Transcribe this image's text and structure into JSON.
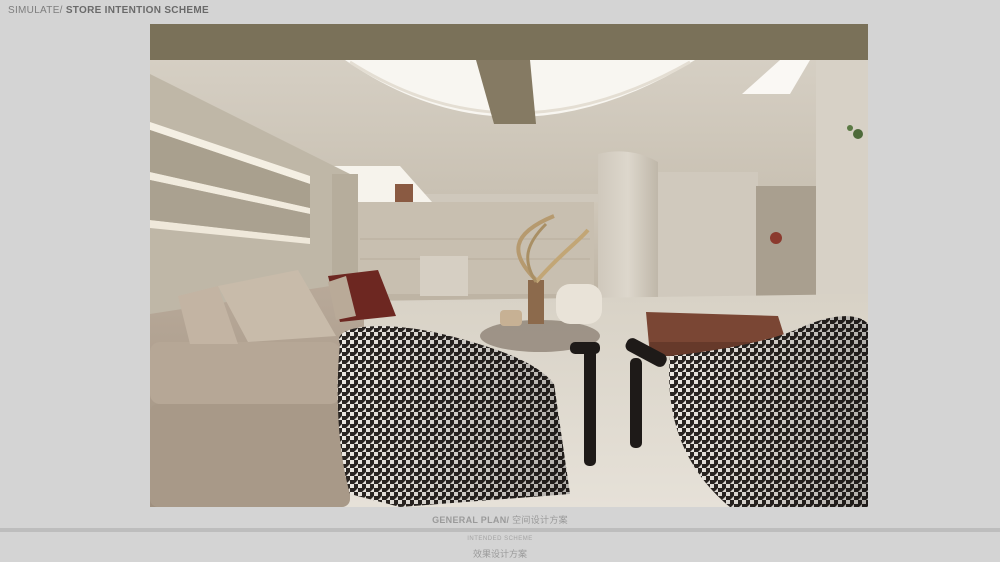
{
  "header": {
    "prefix": "SIMULATE/",
    "title": " STORE INTENTION SCHEME"
  },
  "image": {
    "alt_name": "lounge-interior-render"
  },
  "caption": {
    "main_en": "GENERAL PLAN/",
    "main_cn": " 空间设计方案",
    "sub_en": "INTENDED SCHEME",
    "sub_cn": "效果设计方案"
  },
  "colors": {
    "page_bg": "#d4d4d4",
    "header_text": "#7d7d7d",
    "caption_text": "#9a9a9a",
    "divider": "#bdbdbd"
  }
}
